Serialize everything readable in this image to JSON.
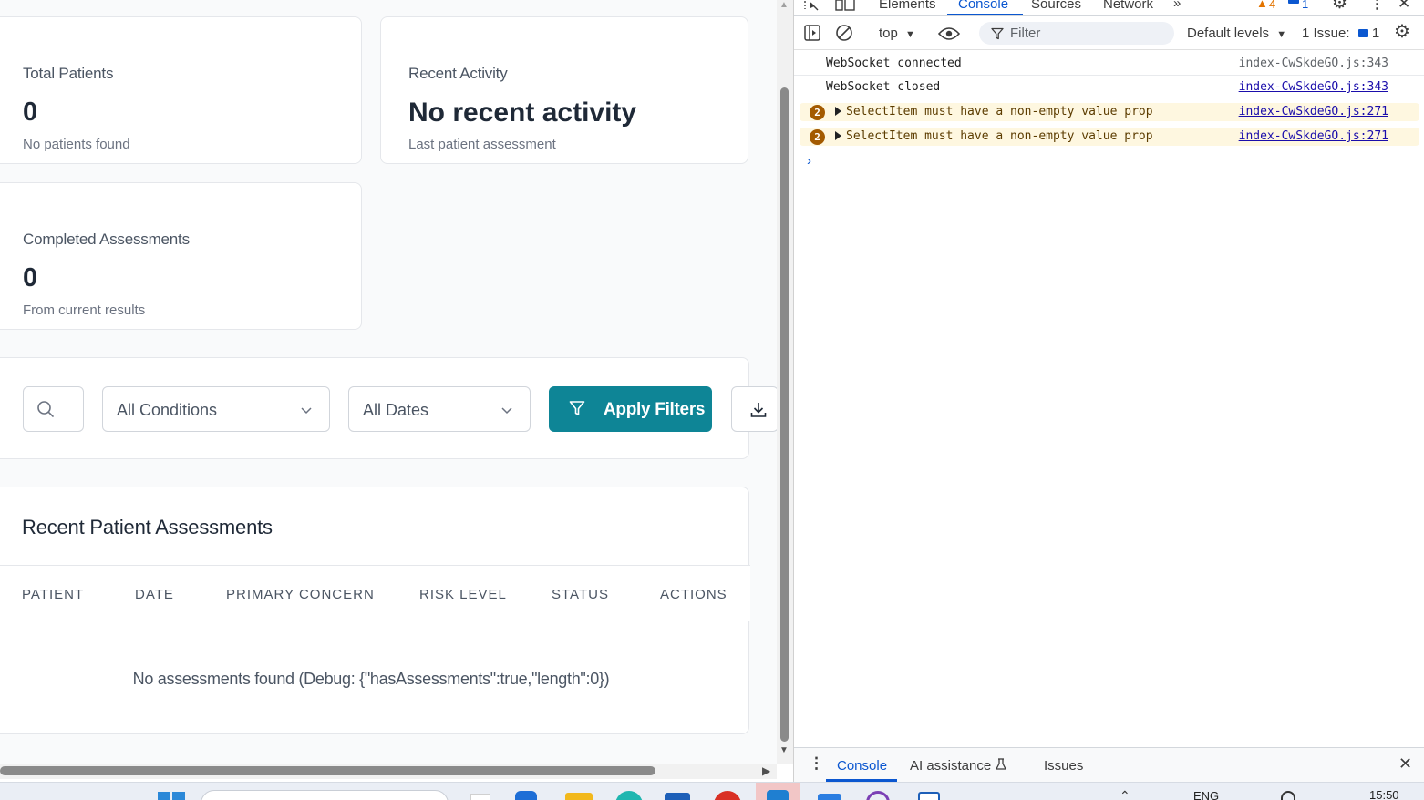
{
  "stats": {
    "total_patients": {
      "title": "Total Patients",
      "value": "0",
      "subtitle": "No patients found"
    },
    "recent_activity": {
      "title": "Recent Activity",
      "value": "No recent activity",
      "subtitle": "Last patient assessment"
    },
    "completed_assessments": {
      "title": "Completed Assessments",
      "value": "0",
      "subtitle": "From current results"
    }
  },
  "filters": {
    "conditions_select": "All Conditions",
    "dates_select": "All Dates",
    "apply_button": "Apply Filters"
  },
  "table": {
    "title": "Recent Patient Assessments",
    "columns": [
      "PATIENT",
      "DATE",
      "PRIMARY CONCERN",
      "RISK LEVEL",
      "STATUS",
      "ACTIONS"
    ],
    "empty_message": "No assessments found (Debug: {\"hasAssessments\":true,\"length\":0})"
  },
  "devtools": {
    "tabs": [
      "Elements",
      "Console",
      "Sources",
      "Network"
    ],
    "active_tab": "Console",
    "warning_count": "4",
    "message_count": "1",
    "toolbar": {
      "context": "top",
      "filter_placeholder": "Filter",
      "levels": "Default levels",
      "issues_label": "1 Issue:",
      "issues_count": "1"
    },
    "logs": [
      {
        "message": "WebSocket connected",
        "source": "index-CwSkdeGO.js:343"
      },
      {
        "message": "WebSocket closed",
        "source": "index-CwSkdeGO.js:343"
      },
      {
        "count": "2",
        "message": "SelectItem must have a non-empty value prop",
        "source": "index-CwSkdeGO.js:271"
      },
      {
        "count": "2",
        "message": "SelectItem must have a non-empty value prop",
        "source": "index-CwSkdeGO.js:271"
      }
    ],
    "drawer_tabs": [
      "Console",
      "AI assistance",
      "Issues"
    ]
  },
  "taskbar": {
    "language": "ENG",
    "time": "15:50"
  },
  "colors": {
    "accent": "#0e8596",
    "devtools_blue": "#0b57d0",
    "warning_bg": "#fef7e0"
  }
}
